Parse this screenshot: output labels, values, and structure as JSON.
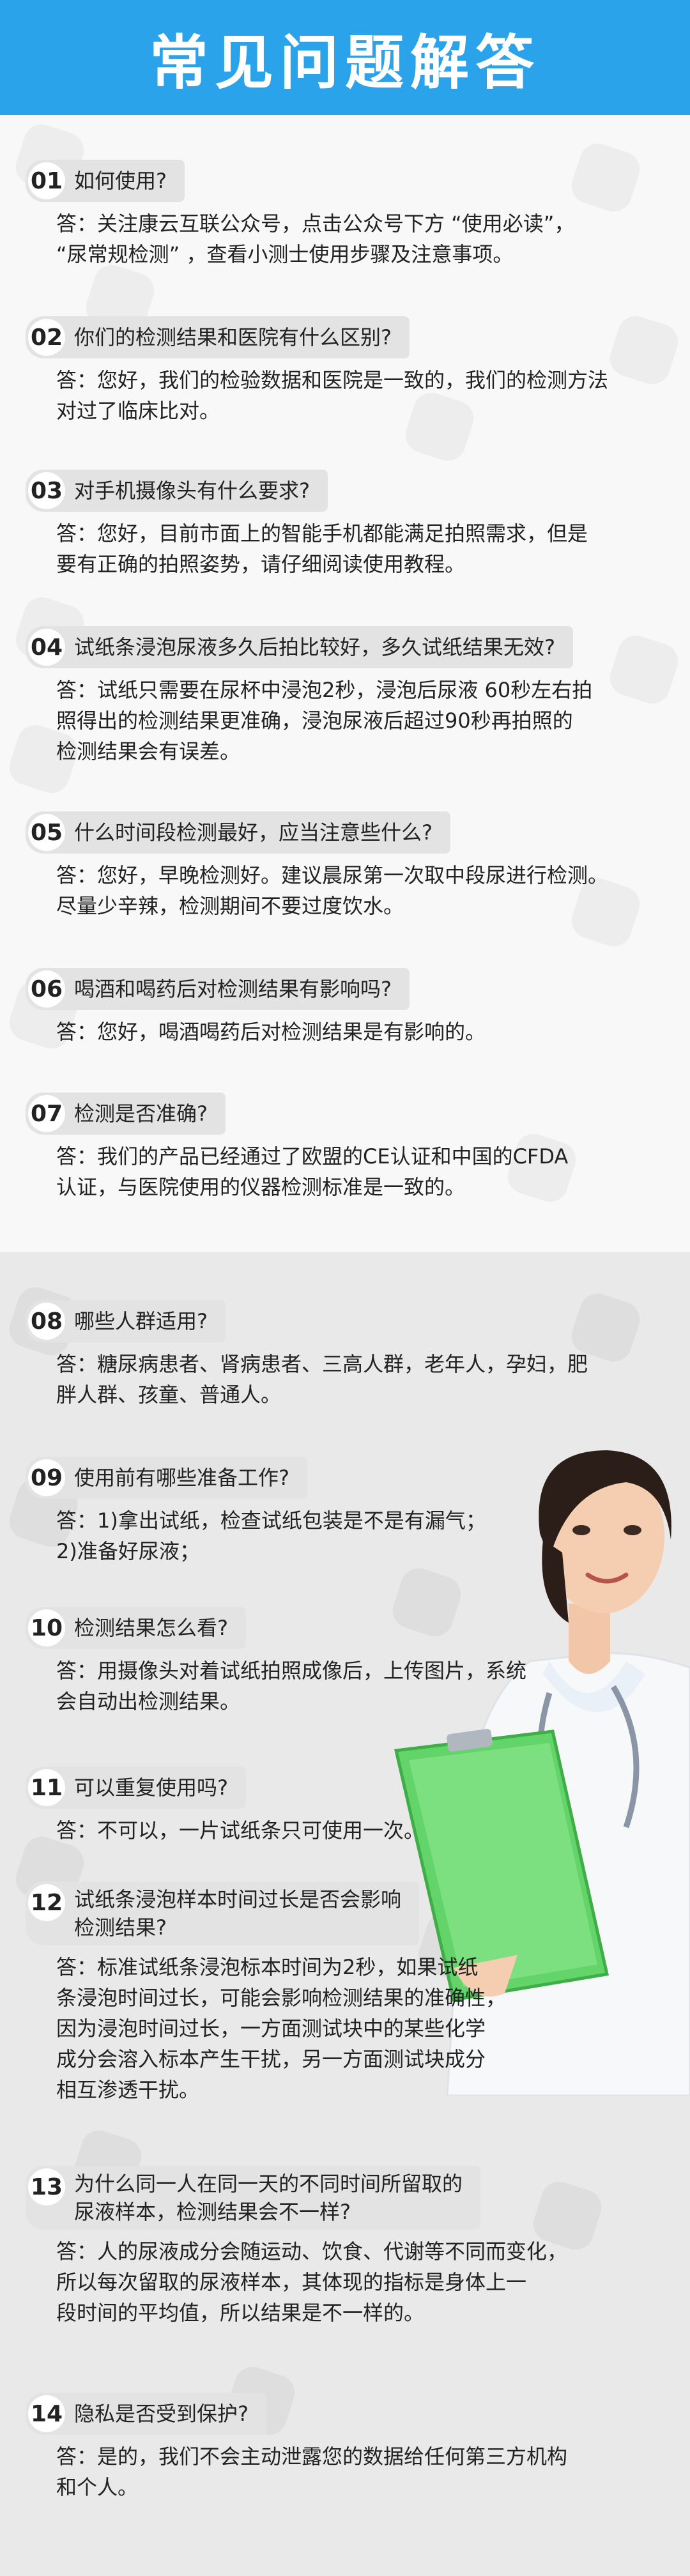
{
  "header": {
    "title": "常见问题解答"
  },
  "faq": [
    {
      "num": "01",
      "q": "如何使用?",
      "a": "答：关注康云互联公众号，点击公众号下方 “使用必读”，\n“尿常规检测” ，查看小测士使用步骤及注意事项。"
    },
    {
      "num": "02",
      "q": "你们的检测结果和医院有什么区别?",
      "a": "答：您好，我们的检验数据和医院是一致的，我们的检测方法\n对过了临床比对。"
    },
    {
      "num": "03",
      "q": "对手机摄像头有什么要求?",
      "a": "答：您好，目前市面上的智能手机都能满足拍照需求，但是\n要有正确的拍照姿势，请仔细阅读使用教程。"
    },
    {
      "num": "04",
      "q": "试纸条浸泡尿液多久后拍比较好，多久试纸结果无效?",
      "a": "答：试纸只需要在尿杯中浸泡2秒，浸泡后尿液 60秒左右拍\n照得出的检测结果更准确，浸泡尿液后超过90秒再拍照的\n检测结果会有误差。"
    },
    {
      "num": "05",
      "q": "什么时间段检测最好，应当注意些什么?",
      "a": "答：您好，早晚检测好。建议晨尿第一次取中段尿进行检测。\n尽量少辛辣，检测期间不要过度饮水。"
    },
    {
      "num": "06",
      "q": "喝酒和喝药后对检测结果有影响吗?",
      "a": "答：您好，喝酒喝药后对检测结果是有影响的。"
    },
    {
      "num": "07",
      "q": "检测是否准确?",
      "a": "答：我们的产品已经通过了欧盟的CE认证和中国的CFDA\n认证，与医院使用的仪器检测标准是一致的。"
    },
    {
      "num": "08",
      "q": "哪些人群适用?",
      "a": "答：糖尿病患者、肾病患者、三高人群，老年人，孕妇，肥\n胖人群、孩童、普通人。"
    },
    {
      "num": "09",
      "q": "使用前有哪些准备工作?",
      "a": "答：1)拿出试纸，检查试纸包装是不是有漏气；\n      2)准备好尿液；"
    },
    {
      "num": "10",
      "q": "检测结果怎么看?",
      "a": "答：用摄像头对着试纸拍照成像后，上传图片，系统\n会自动出检测结果。"
    },
    {
      "num": "11",
      "q": "可以重复使用吗?",
      "a": "答：不可以，一片试纸条只可使用一次。"
    },
    {
      "num": "12",
      "q": "试纸条浸泡样本时间过长是否会影响\n检测结果?",
      "a": "答：标准试纸条浸泡标本时间为2秒，如果试纸\n条浸泡时间过长，可能会影响检测结果的准确性，\n因为浸泡时间过长，一方面测试块中的某些化学\n成分会溶入标本产生干扰，另一方面测试块成分\n相互渗透干扰。"
    },
    {
      "num": "13",
      "q": "为什么同一人在同一天的不同时间所留取的\n尿液样本，检测结果会不一样?",
      "a": "答：人的尿液成分会随运动、饮食、代谢等不同而变化，\n所以每次留取的尿液样本，其体现的指标是身体上一\n段时间的平均值，所以结果是不一样的。"
    },
    {
      "num": "14",
      "q": "隐私是否受到保护?",
      "a": "答：是的，我们不会主动泄露您的数据给任何第三方机构\n和个人。"
    }
  ]
}
